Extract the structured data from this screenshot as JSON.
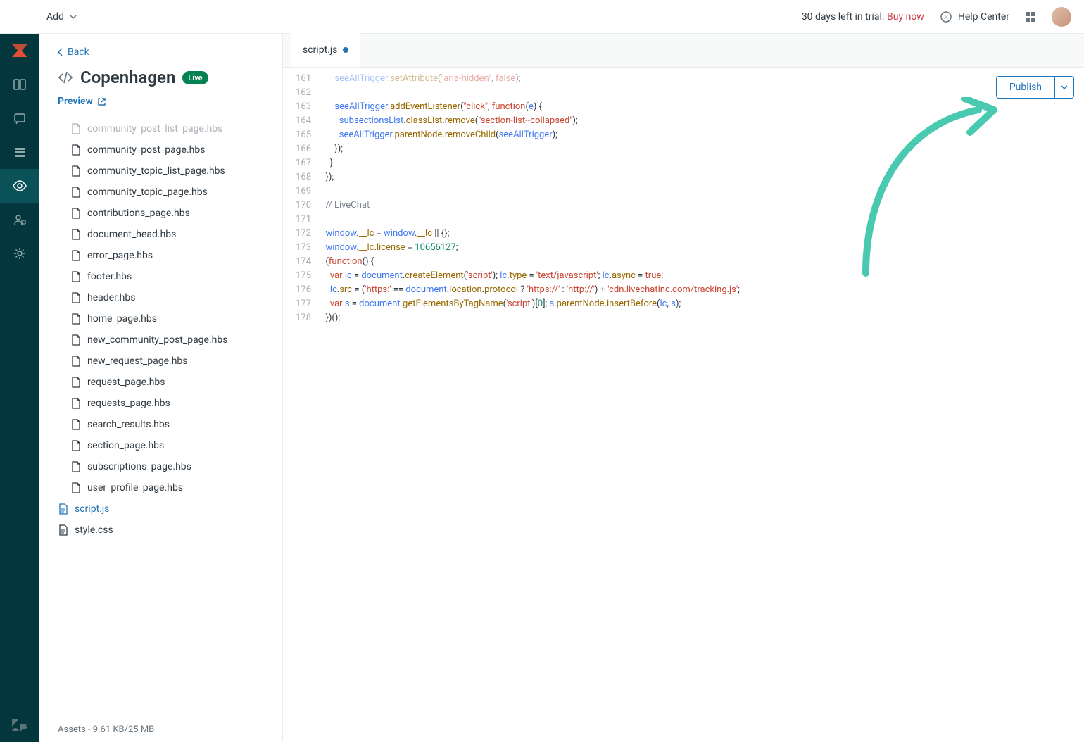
{
  "topbar": {
    "add_label": "Add",
    "trial_text": "30 days left in trial.",
    "buy_label": "Buy now",
    "help_label": "Help Center"
  },
  "sidebar": {
    "back_label": "Back",
    "theme_name": "Copenhagen",
    "live_label": "Live",
    "preview_label": "Preview",
    "files": [
      {
        "name": "community_post_list_page.hbs",
        "truncated": true
      },
      {
        "name": "community_post_page.hbs"
      },
      {
        "name": "community_topic_list_page.hbs"
      },
      {
        "name": "community_topic_page.hbs"
      },
      {
        "name": "contributions_page.hbs"
      },
      {
        "name": "document_head.hbs"
      },
      {
        "name": "error_page.hbs"
      },
      {
        "name": "footer.hbs"
      },
      {
        "name": "header.hbs"
      },
      {
        "name": "home_page.hbs"
      },
      {
        "name": "new_community_post_page.hbs"
      },
      {
        "name": "new_request_page.hbs"
      },
      {
        "name": "request_page.hbs"
      },
      {
        "name": "requests_page.hbs"
      },
      {
        "name": "search_results.hbs"
      },
      {
        "name": "section_page.hbs"
      },
      {
        "name": "subscriptions_page.hbs"
      },
      {
        "name": "user_profile_page.hbs"
      },
      {
        "name": "script.js",
        "active": true,
        "top": true
      },
      {
        "name": "style.css",
        "top": true
      }
    ],
    "assets_label": "Assets - 9.61 KB/25 MB"
  },
  "editor": {
    "tab_label": "script.js",
    "publish_label": "Publish",
    "lines": [
      {
        "n": 161,
        "html": "      <span class='tok-id'>seeAllTrigger</span>.<span class='tok-prop'>setAttribute</span>(<span class='tok-str'>\"aria-hidden\"</span>, <span class='tok-bool'>false</span>);",
        "dim": true
      },
      {
        "n": 162,
        "html": ""
      },
      {
        "n": 163,
        "html": "      <span class='tok-id'>seeAllTrigger</span>.<span class='tok-prop'>addEventListener</span>(<span class='tok-str'>\"click\"</span>, <span class='tok-kw'>function</span>(<span class='tok-id'>e</span>) {"
      },
      {
        "n": 164,
        "html": "        <span class='tok-id'>subsectionsList</span>.<span class='tok-prop'>classList</span>.<span class='tok-prop'>remove</span>(<span class='tok-str'>\"section-list--collapsed\"</span>);"
      },
      {
        "n": 165,
        "html": "        <span class='tok-id'>seeAllTrigger</span>.<span class='tok-prop'>parentNode</span>.<span class='tok-prop'>removeChild</span>(<span class='tok-id'>seeAllTrigger</span>);"
      },
      {
        "n": 166,
        "html": "      });"
      },
      {
        "n": 167,
        "html": "    }"
      },
      {
        "n": 168,
        "html": "  });"
      },
      {
        "n": 169,
        "html": ""
      },
      {
        "n": 170,
        "html": "  <span class='tok-comment'>// LiveChat</span>"
      },
      {
        "n": 171,
        "html": ""
      },
      {
        "n": 172,
        "html": "  <span class='tok-id'>window</span>.<span class='tok-prop'>__lc</span> = <span class='tok-id'>window</span>.<span class='tok-prop'>__lc</span> || {};"
      },
      {
        "n": 173,
        "html": "  <span class='tok-id'>window</span>.<span class='tok-prop'>__lc</span>.<span class='tok-prop'>license</span> = <span class='tok-num'>10656127</span>;"
      },
      {
        "n": 174,
        "html": "  (<span class='tok-kw'>function</span>() {"
      },
      {
        "n": 175,
        "html": "    <span class='tok-kw'>var</span> <span class='tok-id'>lc</span> = <span class='tok-id'>document</span>.<span class='tok-prop'>createElement</span>(<span class='tok-str'>'script'</span>); <span class='tok-id'>lc</span>.<span class='tok-prop'>type</span> = <span class='tok-str'>'text/javascript'</span>; <span class='tok-id'>lc</span>.<span class='tok-prop'>async</span> = <span class='tok-bool'>true</span>;"
      },
      {
        "n": 176,
        "html": "    <span class='tok-id'>lc</span>.<span class='tok-prop'>src</span> = (<span class='tok-str'>'https:'</span> == <span class='tok-id'>document</span>.<span class='tok-prop'>location</span>.<span class='tok-prop'>protocol</span> ? <span class='tok-str'>'https://'</span> : <span class='tok-str'>'http://'</span>) + <span class='tok-str'>'cdn.livechatinc.com/tracking.js'</span>;"
      },
      {
        "n": 177,
        "html": "    <span class='tok-kw'>var</span> <span class='tok-id'>s</span> = <span class='tok-id'>document</span>.<span class='tok-prop'>getElementsByTagName</span>(<span class='tok-str'>'script'</span>)[<span class='tok-num'>0</span>]; <span class='tok-id'>s</span>.<span class='tok-prop'>parentNode</span>.<span class='tok-prop'>insertBefore</span>(<span class='tok-id'>lc</span>, <span class='tok-id'>s</span>);"
      },
      {
        "n": 178,
        "html": "  })();"
      }
    ]
  }
}
